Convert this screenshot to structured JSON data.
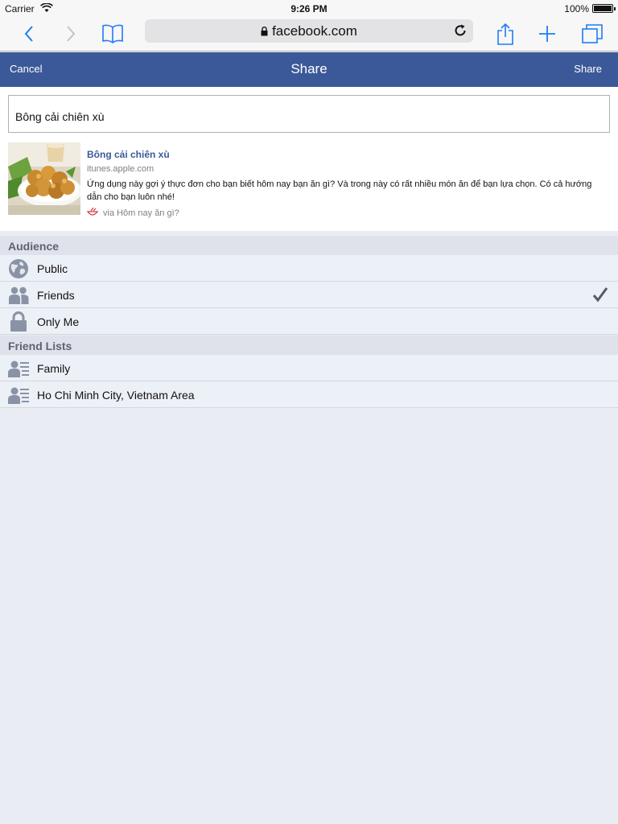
{
  "status_bar": {
    "carrier": "Carrier",
    "time": "9:26 PM",
    "battery": "100%"
  },
  "browser": {
    "url": "facebook.com",
    "accent_color": "#1f7cf3"
  },
  "dialog": {
    "cancel_label": "Cancel",
    "title": "Share",
    "share_label": "Share",
    "header_color": "#3b5998"
  },
  "composer": {
    "message": "Bông cải chiên xù"
  },
  "preview": {
    "title": "Bông cải chiên xù",
    "domain": "itunes.apple.com",
    "description": "Ứng dụng này gợi ý thực đơn cho bạn biết hôm nay bạn ăn gì? Và trong này có rất nhiều món ăn để bạn lựa chọn. Có cả hướng dẫn cho bạn luôn nhé!",
    "via": "via Hôm nay ăn gì?"
  },
  "audience": {
    "heading": "Audience",
    "items": [
      {
        "label": "Public",
        "icon": "globe-icon",
        "selected": false
      },
      {
        "label": "Friends",
        "icon": "friends-icon",
        "selected": true
      },
      {
        "label": "Only Me",
        "icon": "lock-icon",
        "selected": false
      }
    ]
  },
  "friend_lists": {
    "heading": "Friend Lists",
    "items": [
      {
        "label": "Family",
        "icon": "friend-list-icon"
      },
      {
        "label": "Ho Chi Minh City, Vietnam Area",
        "icon": "friend-list-icon"
      }
    ]
  }
}
